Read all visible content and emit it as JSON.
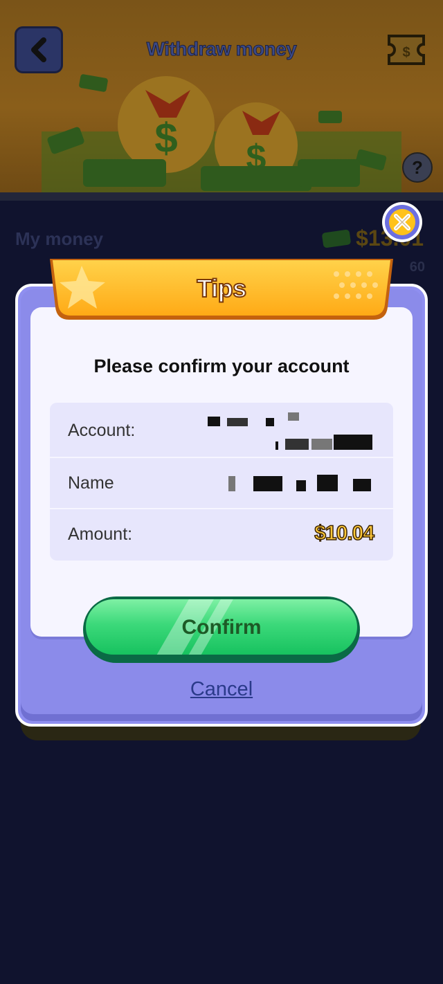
{
  "header": {
    "title": "Withdraw money",
    "back_icon": "chevron-left-icon",
    "ticket_icon": "ticket-icon",
    "help_label": "?"
  },
  "balance": {
    "label": "My money",
    "value": "$13.01",
    "sub": "60"
  },
  "modal": {
    "banner_title": "Tips",
    "heading": "Please confirm your account",
    "rows": [
      {
        "label": "Account:"
      },
      {
        "label": "Name"
      },
      {
        "label": "Amount:",
        "value": "$10.04"
      }
    ],
    "confirm_label": "Confirm",
    "cancel_label": "Cancel",
    "close_icon": "close-icon"
  },
  "colors": {
    "background": "#10132e",
    "modal_frame": "#8f8ff0",
    "banner": "#ffb72a",
    "confirm_green": "#2fd470",
    "amount_gold": "#ffc93a",
    "close_yellow": "#ffc21a"
  }
}
